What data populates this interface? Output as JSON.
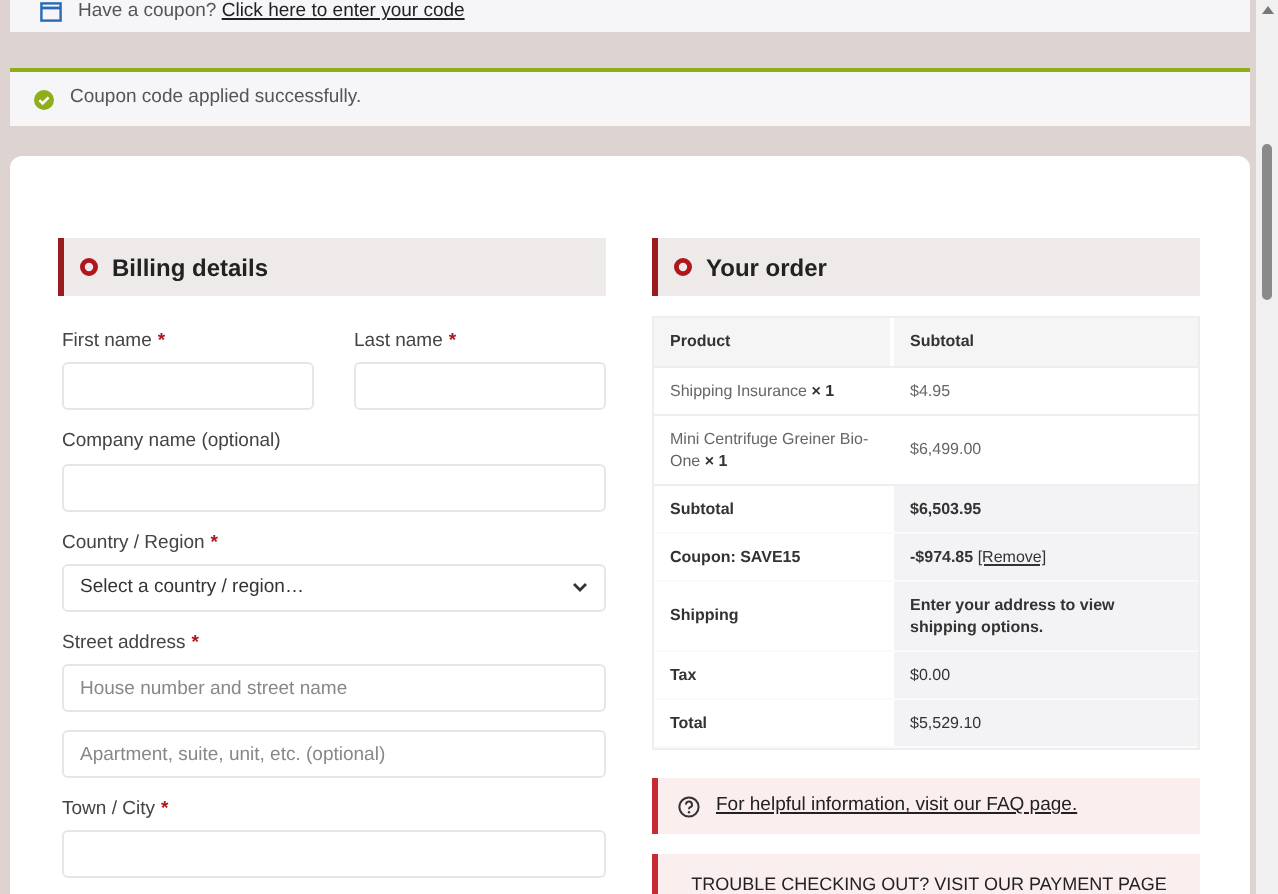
{
  "coupon_notice": {
    "text": "Have a coupon?",
    "link": "Click here to enter your code"
  },
  "success_message": {
    "text": "Coupon code applied successfully."
  },
  "billing": {
    "title": "Billing details",
    "fields": [
      {
        "label": "First name",
        "required_mark": "*",
        "kind": "half_text"
      },
      {
        "label": "Last name",
        "required_mark": "*",
        "kind": "half_text"
      },
      {
        "label": "Company name (optional)",
        "kind": "text"
      },
      {
        "label": "Country / Region",
        "required_mark": "*",
        "kind": "select",
        "value": "Select a country / region…"
      },
      {
        "label": "Street address",
        "required_mark": "*",
        "kind": "text",
        "placeholder": "House number and street name"
      },
      {
        "kind": "text",
        "placeholder": "Apartment, suite, unit, etc. (optional)"
      },
      {
        "label": "Town / City",
        "required_mark": "*",
        "kind": "text"
      }
    ]
  },
  "order": {
    "title": "Your order",
    "columns": [
      "Product",
      "Subtotal"
    ],
    "items": [
      {
        "name": "Shipping Insurance",
        "qty": "× 1",
        "subtotal": "$4.95"
      },
      {
        "name": "Mini Centrifuge Greiner Bio-One",
        "qty": "× 1",
        "subtotal": "$6,499.00"
      }
    ],
    "totals": [
      {
        "label": "Subtotal",
        "value": "$6,503.95",
        "bold": true
      },
      {
        "label": "Coupon: SAVE15",
        "value": "-$974.85",
        "link": "[Remove]",
        "bold": true
      },
      {
        "label": "Shipping",
        "value": "Enter your address to view shipping options.",
        "bold": true
      },
      {
        "label": "Tax",
        "value": "$0.00",
        "bold": false
      },
      {
        "label": "Total",
        "value": "$5,529.10",
        "bold": false
      }
    ]
  },
  "faq_notice": {
    "link": "For helpful information, visit our FAQ page."
  },
  "payment_notice": {
    "text": "TROUBLE CHECKING OUT? VISIT OUR PAYMENT PAGE"
  }
}
